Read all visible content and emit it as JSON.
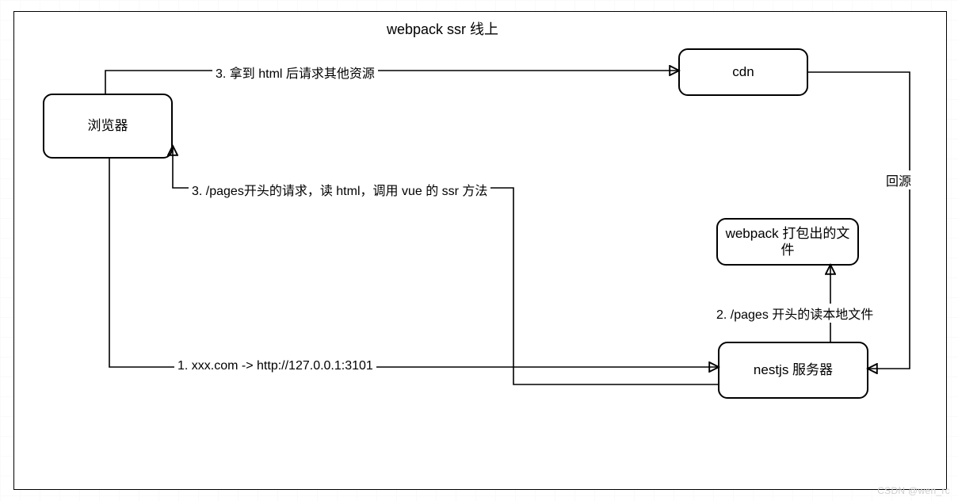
{
  "title": "webpack ssr 线上",
  "nodes": {
    "browser": "浏览器",
    "cdn": "cdn",
    "bundle": "webpack 打包出的文件",
    "nestjs": "nestjs 服务器"
  },
  "edges": {
    "e1": "1. xxx.com -> http://127.0.0.1:3101",
    "e2": "2. /pages 开头的读本地文件",
    "e3_ssr": "3. /pages开头的请求，读 html，调用 vue  的 ssr 方法",
    "e3_cdn": "3. 拿到 html 后请求其他资源",
    "e_back": "回源"
  },
  "watermark": "CSDN @wen_rc"
}
